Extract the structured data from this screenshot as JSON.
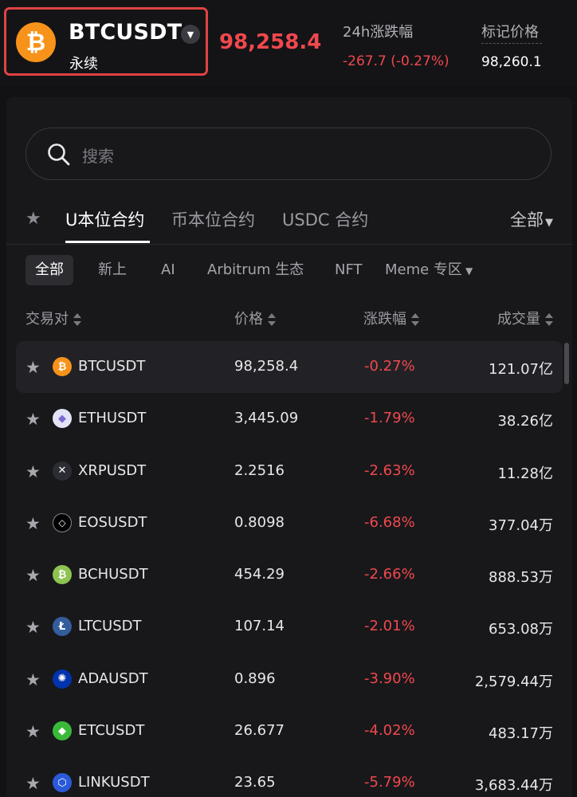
{
  "header": {
    "symbol": "BTCUSDT",
    "contract_type": "永续",
    "last_price": "98,258.4",
    "stats": [
      {
        "label": "24h涨跌幅",
        "value": "-267.7 (-0.27%)",
        "color": "#f0484d"
      },
      {
        "label": "标记价格",
        "value": "98,260.1",
        "color": "#ffffff"
      }
    ]
  },
  "search": {
    "placeholder": "搜索"
  },
  "tabs": {
    "items": [
      "U本位合约",
      "币本位合约",
      "USDC 合约"
    ],
    "active": 0,
    "all_label": "全部"
  },
  "chips": {
    "items": [
      "全部",
      "新上",
      "AI",
      "Arbitrum 生态",
      "NFT",
      "Meme 专区"
    ],
    "active": 0
  },
  "table": {
    "headers": [
      "交易对",
      "价格",
      "涨跌幅",
      "成交量"
    ],
    "rows": [
      {
        "pair": "BTCUSDT",
        "price": "98,258.4",
        "change": "-0.27%",
        "volume": "121.07亿",
        "icon": "bitcoin-icon",
        "color": "#f7931a"
      },
      {
        "pair": "ETHUSDT",
        "price": "3,445.09",
        "change": "-1.79%",
        "volume": "38.26亿",
        "icon": "ethereum-icon",
        "color": "#e2e4f6"
      },
      {
        "pair": "XRPUSDT",
        "price": "2.2516",
        "change": "-2.63%",
        "volume": "11.28亿",
        "icon": "xrp-icon",
        "color": "#2b2d33"
      },
      {
        "pair": "EOSUSDT",
        "price": "0.8098",
        "change": "-6.68%",
        "volume": "377.04万",
        "icon": "eos-icon",
        "color": "#000000"
      },
      {
        "pair": "BCHUSDT",
        "price": "454.29",
        "change": "-2.66%",
        "volume": "888.53万",
        "icon": "bitcoin-cash-icon",
        "color": "#8dc351"
      },
      {
        "pair": "LTCUSDT",
        "price": "107.14",
        "change": "-2.01%",
        "volume": "653.08万",
        "icon": "litecoin-icon",
        "color": "#345d9d"
      },
      {
        "pair": "ADAUSDT",
        "price": "0.896",
        "change": "-3.90%",
        "volume": "2,579.44万",
        "icon": "cardano-icon",
        "color": "#0033ad"
      },
      {
        "pair": "ETCUSDT",
        "price": "26.677",
        "change": "-4.02%",
        "volume": "483.17万",
        "icon": "ethereum-classic-icon",
        "color": "#3ab83a"
      },
      {
        "pair": "LINKUSDT",
        "price": "23.65",
        "change": "-5.79%",
        "volume": "3,683.44万",
        "icon": "chainlink-icon",
        "color": "#2a5ada"
      }
    ]
  },
  "colors": {
    "accent_red": "#f0484d",
    "highlight_border": "#e04343"
  }
}
